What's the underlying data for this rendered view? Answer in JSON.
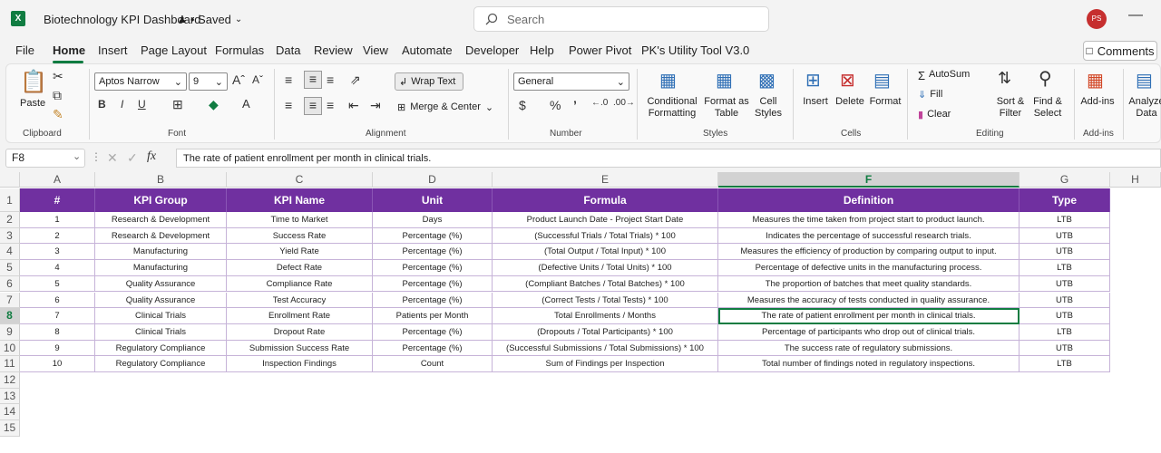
{
  "titlebar": {
    "doc_title": "Biotechnology KPI Dashboard",
    "saved_label": "• Saved",
    "search_placeholder": "Search",
    "avatar_initials": "PS"
  },
  "menu": {
    "items": [
      "File",
      "Home",
      "Insert",
      "Page Layout",
      "Formulas",
      "Data",
      "Review",
      "View",
      "Automate",
      "Developer",
      "Help",
      "Power Pivot",
      "PK's Utility Tool V3.0"
    ],
    "active": "Home",
    "comments_label": "Comments"
  },
  "ribbon": {
    "clipboard": {
      "paste": "Paste",
      "label": "Clipboard"
    },
    "font": {
      "name": "Aptos Narrow",
      "size": "9",
      "label": "Font"
    },
    "alignment": {
      "wrap": "Wrap Text",
      "merge": "Merge & Center",
      "label": "Alignment"
    },
    "number": {
      "format": "General",
      "label": "Number"
    },
    "styles": {
      "cond1": "Conditional",
      "cond2": "Formatting",
      "fmt1": "Format as",
      "fmt2": "Table",
      "cell1": "Cell",
      "cell2": "Styles",
      "label": "Styles"
    },
    "cells": {
      "insert": "Insert",
      "delete": "Delete",
      "format": "Format",
      "label": "Cells"
    },
    "editing": {
      "autosum": "AutoSum",
      "fill": "Fill",
      "clear": "Clear",
      "sort1": "Sort &",
      "sort2": "Filter",
      "find1": "Find &",
      "find2": "Select",
      "label": "Editing"
    },
    "addins": {
      "btn": "Add-ins",
      "label": "Add-ins"
    },
    "analyze": {
      "line1": "Analyze",
      "line2": "Data"
    }
  },
  "formula_bar": {
    "namebox": "F8",
    "content": "The rate of patient enrollment per month in clinical trials."
  },
  "sheet": {
    "col_letters": [
      "A",
      "B",
      "C",
      "D",
      "E",
      "F",
      "G",
      "H"
    ],
    "row_numbers": [
      "1",
      "2",
      "3",
      "4",
      "5",
      "6",
      "7",
      "8",
      "9",
      "10",
      "11",
      "12",
      "13",
      "14",
      "15"
    ],
    "headers": [
      "#",
      "KPI Group",
      "KPI Name",
      "Unit",
      "Formula",
      "Definition",
      "Type"
    ],
    "rows": [
      [
        "1",
        "Research & Development",
        "Time to Market",
        "Days",
        "Product Launch Date - Project Start Date",
        "Measures the time taken from project start to product launch.",
        "LTB"
      ],
      [
        "2",
        "Research & Development",
        "Success Rate",
        "Percentage (%)",
        "(Successful Trials / Total Trials) * 100",
        "Indicates the percentage of successful research trials.",
        "UTB"
      ],
      [
        "3",
        "Manufacturing",
        "Yield Rate",
        "Percentage (%)",
        "(Total Output / Total Input) * 100",
        "Measures the efficiency of production by comparing output to input.",
        "UTB"
      ],
      [
        "4",
        "Manufacturing",
        "Defect Rate",
        "Percentage (%)",
        "(Defective Units / Total Units) * 100",
        "Percentage of defective units in the manufacturing process.",
        "LTB"
      ],
      [
        "5",
        "Quality Assurance",
        "Compliance Rate",
        "Percentage (%)",
        "(Compliant Batches / Total Batches) * 100",
        "The proportion of batches that meet quality standards.",
        "UTB"
      ],
      [
        "6",
        "Quality Assurance",
        "Test Accuracy",
        "Percentage (%)",
        "(Correct Tests / Total Tests) * 100",
        "Measures the accuracy of tests conducted in quality assurance.",
        "UTB"
      ],
      [
        "7",
        "Clinical Trials",
        "Enrollment Rate",
        "Patients per Month",
        "Total Enrollments / Months",
        "The rate of patient enrollment per month in clinical trials.",
        "UTB"
      ],
      [
        "8",
        "Clinical Trials",
        "Dropout Rate",
        "Percentage (%)",
        "(Dropouts / Total Participants) * 100",
        "Percentage of participants who drop out of clinical trials.",
        "LTB"
      ],
      [
        "9",
        "Regulatory Compliance",
        "Submission Success Rate",
        "Percentage (%)",
        "(Successful Submissions / Total Submissions) * 100",
        "The success rate of regulatory submissions.",
        "UTB"
      ],
      [
        "10",
        "Regulatory Compliance",
        "Inspection Findings",
        "Count",
        "Sum of Findings per Inspection",
        "Total number of findings noted in regulatory inspections.",
        "LTB"
      ]
    ],
    "header_color": "#7030a0",
    "accent_color": "#107c41"
  }
}
